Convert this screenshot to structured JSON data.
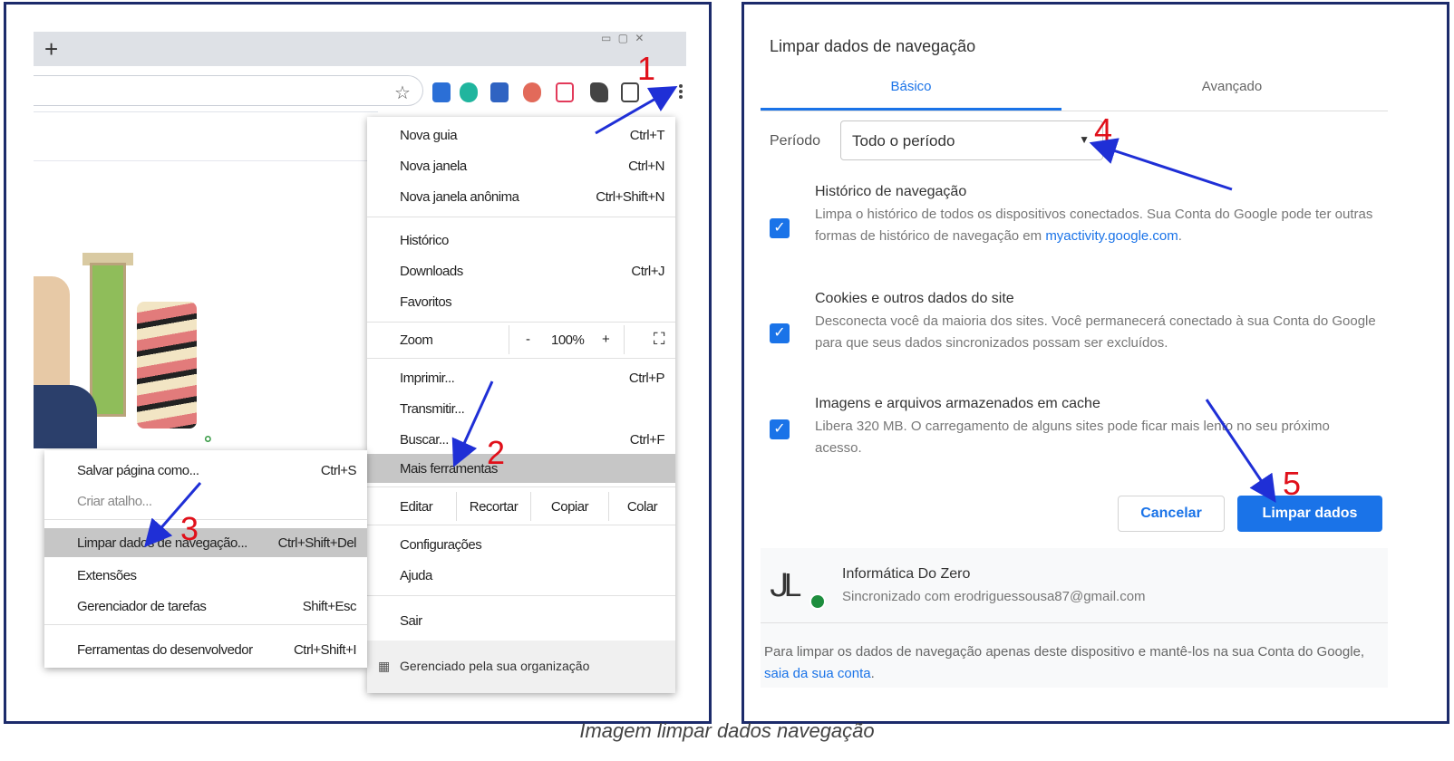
{
  "caption": "Imagem limpar dados navegação",
  "browser": {
    "new_tab_symbol": "+",
    "star_icon": "☆",
    "extension_colors": [
      "#2b6fd6",
      "#20b59e",
      "#2f63c2",
      "#e26a5a",
      "#e23a5a",
      "#444444",
      "#444444"
    ]
  },
  "main_menu": {
    "items": [
      {
        "label": "Nova guia",
        "shortcut": "Ctrl+T"
      },
      {
        "label": "Nova janela",
        "shortcut": "Ctrl+N"
      },
      {
        "label": "Nova janela anônima",
        "shortcut": "Ctrl+Shift+N"
      },
      {
        "label": "Histórico",
        "shortcut": ""
      },
      {
        "label": "Downloads",
        "shortcut": "Ctrl+J"
      },
      {
        "label": "Favoritos",
        "shortcut": ""
      },
      {
        "label": "Imprimir...",
        "shortcut": "Ctrl+P"
      },
      {
        "label": "Transmitir...",
        "shortcut": ""
      },
      {
        "label": "Buscar...",
        "shortcut": "Ctrl+F"
      },
      {
        "label": "Mais ferramentas",
        "shortcut": ""
      },
      {
        "label": "Configurações",
        "shortcut": ""
      },
      {
        "label": "Ajuda",
        "shortcut": ""
      },
      {
        "label": "Sair",
        "shortcut": ""
      }
    ],
    "zoom": {
      "label": "Zoom",
      "minus": "-",
      "value": "100%",
      "plus": "+",
      "fullscreen": "⛶"
    },
    "edit": {
      "label": "Editar",
      "cut": "Recortar",
      "copy": "Copiar",
      "paste": "Colar"
    },
    "managed": "Gerenciado pela sua organização"
  },
  "sub_menu": {
    "items": [
      {
        "label": "Salvar página como...",
        "shortcut": "Ctrl+S"
      },
      {
        "label": "Criar atalho...",
        "shortcut": ""
      },
      {
        "label": "Limpar dados de navegação...",
        "shortcut": "Ctrl+Shift+Del"
      },
      {
        "label": "Extensões",
        "shortcut": ""
      },
      {
        "label": "Gerenciador de tarefas",
        "shortcut": "Shift+Esc"
      },
      {
        "label": "Ferramentas do desenvolvedor",
        "shortcut": "Ctrl+Shift+I"
      }
    ]
  },
  "step_numbers": [
    "1",
    "2",
    "3",
    "4",
    "5"
  ],
  "dialog": {
    "title": "Limpar dados de navegação",
    "tabs": [
      "Básico",
      "Avançado"
    ],
    "period_label": "Período",
    "period_value": "Todo o período",
    "options": [
      {
        "title": "Histórico de navegação",
        "desc": "Limpa o histórico de todos os dispositivos conectados. Sua Conta do Google pode ter outras formas de histórico de navegação em",
        "link": "myactivity.google.com",
        "suffix": ".",
        "checked": true
      },
      {
        "title": "Cookies e outros dados do site",
        "desc": "Desconecta você da maioria dos sites. Você permanecerá conectado à sua Conta do Google para que seus dados sincronizados possam ser excluídos.",
        "checked": true
      },
      {
        "title": "Imagens e arquivos armazenados em cache",
        "desc": "Libera 320 MB. O carregamento de alguns sites pode ficar mais lento no seu próximo acesso.",
        "checked": true
      }
    ],
    "cancel": "Cancelar",
    "clear": "Limpar dados",
    "account_name": "Informática Do Zero",
    "account_sync": "Sincronizado com erodriguessousa87@gmail.com",
    "footer_text": "Para limpar os dados de navegação apenas deste dispositivo e mantê-los na sua Conta do Google,",
    "footer_link": "saia da sua conta",
    "footer_end": ".",
    "accent": "#1a73e8"
  },
  "annotation_color": "#1f2fd6",
  "number_color": "#e0101a"
}
